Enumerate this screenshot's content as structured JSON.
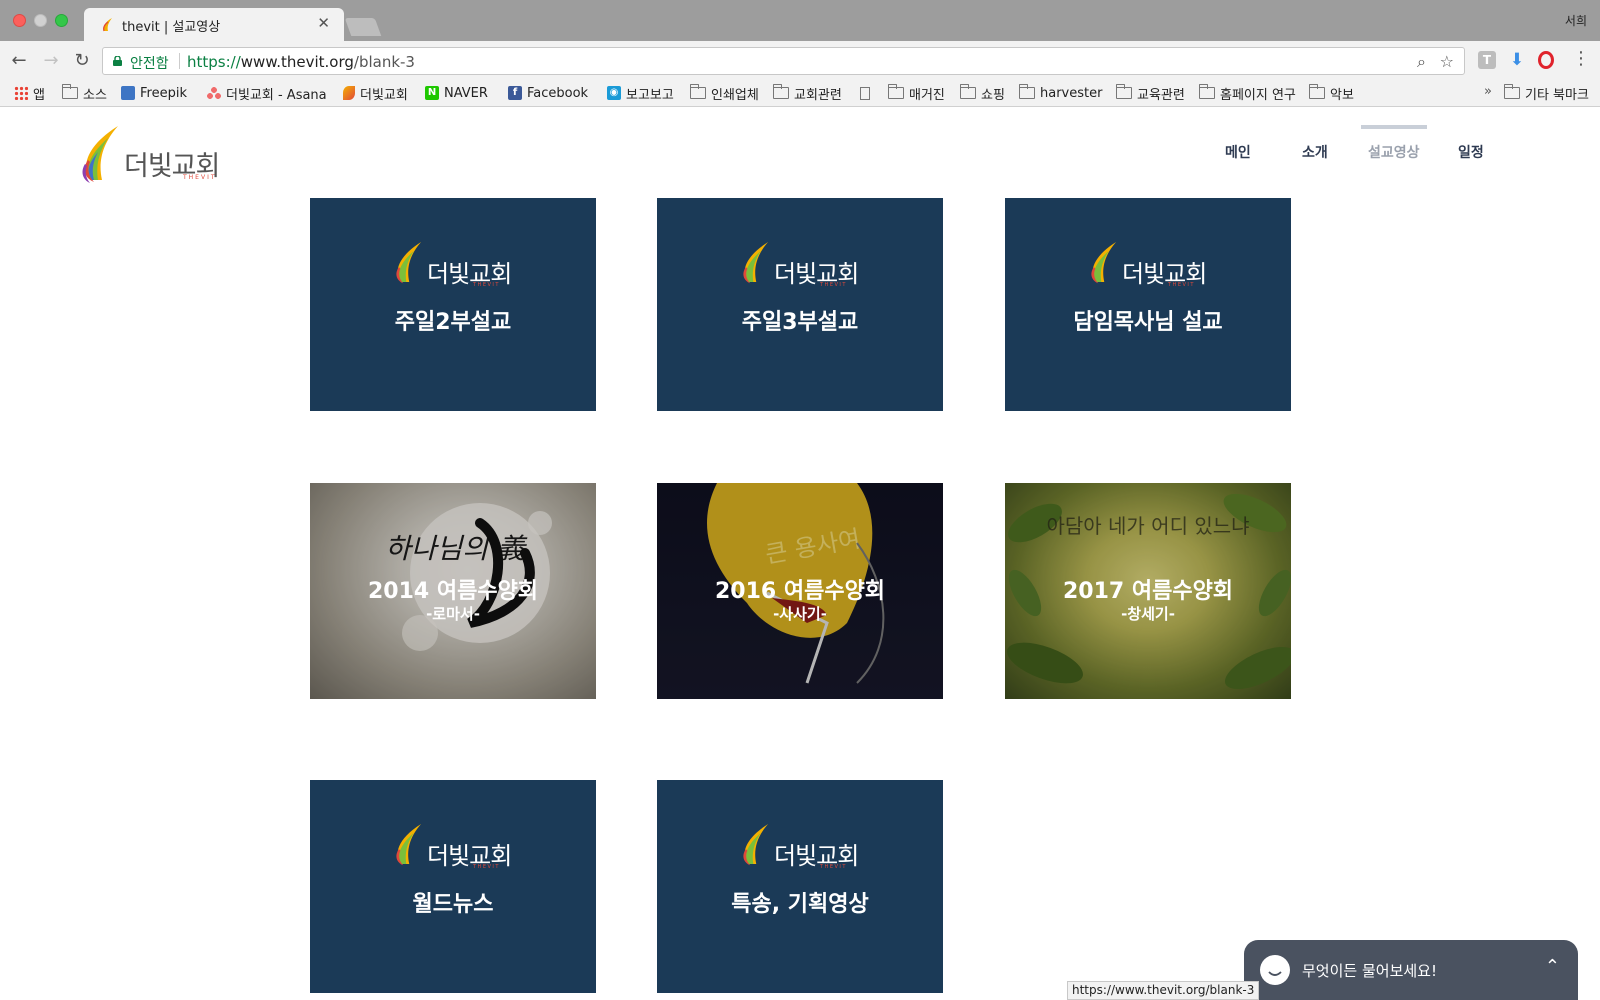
{
  "browser": {
    "tab_title": "thevit | 설교영상",
    "profile_name": "서희",
    "secure_label": "안전함",
    "url_scheme": "https://",
    "url_host": "www.thevit.org",
    "url_path": "/blank-3",
    "status_url": "https://www.thevit.org/blank-3",
    "ext_t_label": "T"
  },
  "bookmarks": [
    {
      "label": "앱",
      "icon": "apps-grid-icon"
    },
    {
      "label": "소스",
      "icon": "folder-icon"
    },
    {
      "label": "Freepik",
      "icon": "freepik-icon"
    },
    {
      "label": "더빛교회 - Asana",
      "icon": "asana-icon"
    },
    {
      "label": "더빛교회",
      "icon": "thevit-favicon-icon"
    },
    {
      "label": "NAVER",
      "icon": "naver-icon",
      "badge": "N"
    },
    {
      "label": "Facebook",
      "icon": "facebook-icon",
      "badge": "f"
    },
    {
      "label": "보고보고",
      "icon": "bogobogo-icon"
    },
    {
      "label": "인쇄업체",
      "icon": "folder-icon"
    },
    {
      "label": "교회관련",
      "icon": "folder-icon"
    },
    {
      "label": "",
      "icon": "document-icon"
    },
    {
      "label": "매거진",
      "icon": "folder-icon"
    },
    {
      "label": "쇼핑",
      "icon": "folder-icon"
    },
    {
      "label": "harvester",
      "icon": "folder-icon"
    },
    {
      "label": "교육관련",
      "icon": "folder-icon"
    },
    {
      "label": "홈페이지 연구",
      "icon": "folder-icon"
    },
    {
      "label": "악보",
      "icon": "folder-icon"
    }
  ],
  "bookmarks_overflow": "»",
  "bookmarks_other": "기타 북마크",
  "site": {
    "logo_text": "더빛교회",
    "logo_sub": "THEVIT",
    "nav": [
      "메인",
      "소개",
      "설교영상",
      "일정"
    ],
    "active_nav": "설교영상"
  },
  "cards": [
    {
      "title": "주일2부설교",
      "style": "navy"
    },
    {
      "title": "주일3부설교",
      "style": "navy"
    },
    {
      "title": "담임목사님 설교",
      "style": "navy"
    },
    {
      "title": "2014 여름수양회",
      "subtitle": "-로마서-",
      "style": "image",
      "image_text": "하나님의 義"
    },
    {
      "title": "2016 여름수양회",
      "subtitle": "-사사기-",
      "style": "image",
      "image_text": "큰 용사여"
    },
    {
      "title": "2017 여름수양회",
      "subtitle": "-창세기-",
      "style": "image",
      "image_text": "아담아 네가 어디 있느냐"
    },
    {
      "title": "월드뉴스",
      "style": "navy"
    },
    {
      "title": "특송, 기획영상",
      "style": "navy"
    }
  ],
  "chat": {
    "placeholder": "무엇이든 물어보세요!"
  },
  "colors": {
    "card_navy": "#1b3a57",
    "nav_text": "#2f3b52",
    "nav_active": "#9aa1ad",
    "secure_green": "#0b8043",
    "chat_bg": "#4a5260"
  }
}
